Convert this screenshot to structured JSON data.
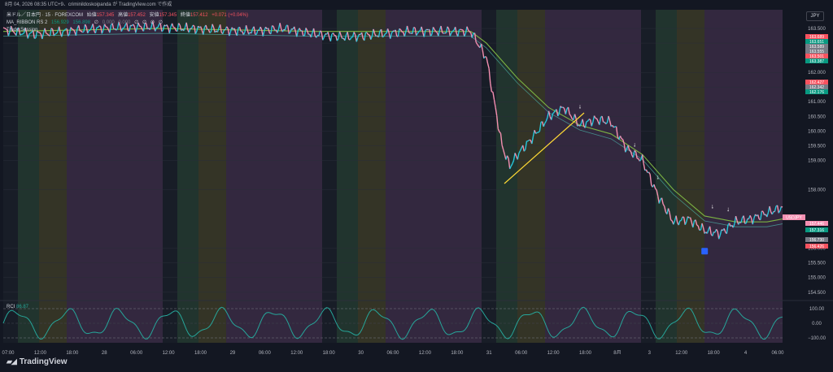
{
  "header": {
    "timestamp_line": "8月 04, 2026 08:35 UTC+9、criminildoskoipanda が TradingView.com で作成"
  },
  "legend": {
    "symbol": "米ドル／日本円 · 15 · FOREXCOM",
    "open_label": "始値",
    "open": "157.345",
    "high_label": "高値",
    "high": "157.452",
    "low_label": "安値",
    "low": "157.345",
    "close_label": "終値",
    "close": "157.412",
    "change": "+0.071 (+0.04%)",
    "indicator1": "MA_RIBBON RS 2",
    "indicator1_values": [
      "156.929",
      "156.898",
      "∅",
      "0.000",
      "0.000",
      "∅",
      "∅",
      "∅",
      "∅"
    ],
    "indicator2": "Trade Session"
  },
  "currency_badge": "JPY",
  "rci": {
    "label": "RCI",
    "value": "86.87",
    "ticks": [
      "100.00",
      "0.00",
      "−100.00"
    ]
  },
  "branding": {
    "name": "TradingView"
  },
  "colors": {
    "background": "#131722",
    "up": "#26c6da",
    "down": "#f48fb1",
    "ma_fast": "#7cb342",
    "ma_slow": "#4db6ac",
    "trendline": "#fdd835",
    "rci_line": "#26a69a",
    "session_purple": "#3a2c44",
    "session_olive": "#3b3a27",
    "session_green": "#243a30",
    "session_blank": "#1a1e28"
  },
  "chart_data": {
    "type": "line",
    "title": "米ドル／日本円 · 15 · FOREXCOM",
    "y_axis_ticks": [
      154.5,
      155.0,
      155.5,
      156.0,
      158.0,
      159.0,
      159.5,
      160.0,
      160.5,
      161.0,
      161.5,
      162.0,
      163.0,
      163.5
    ],
    "ylim": [
      154.3,
      164.0
    ],
    "x_tick_labels": [
      "07:00",
      "12:00",
      "18:00",
      "28",
      "06:00",
      "12:00",
      "18:00",
      "29",
      "06:00",
      "12:00",
      "18:00",
      "30",
      "06:00",
      "12:00",
      "18:00",
      "31",
      "06:00",
      "12:00",
      "18:00",
      "8月",
      "3",
      "12:00",
      "18:00",
      "4",
      "06:00"
    ],
    "price_labels": [
      {
        "value": "163.689",
        "color": "#f7525f"
      },
      {
        "value": "163.651",
        "color": "#089981"
      },
      {
        "value": "163.589",
        "color": "#787b86"
      },
      {
        "value": "163.555",
        "color": "#787b86"
      },
      {
        "value": "163.501",
        "color": "#f7525f"
      },
      {
        "value": "163.387",
        "color": "#089981"
      },
      {
        "value": "162.427",
        "color": "#f7525f"
      },
      {
        "value": "162.342",
        "color": "#787b86"
      },
      {
        "value": "162.176",
        "color": "#089981"
      },
      {
        "value": "157.446",
        "color": "#f48fb1"
      },
      {
        "value": "157.316",
        "color": "#089981"
      },
      {
        "value": "156.730",
        "color": "#787b86"
      },
      {
        "value": "156.426",
        "color": "#f7525f"
      }
    ],
    "last_price_tag": "USDJPY",
    "series": [
      {
        "name": "米ドル／日本円",
        "x": [
          0,
          4,
          8,
          12,
          16,
          20,
          24,
          28,
          32,
          36,
          40,
          44,
          48,
          52,
          56,
          60,
          62,
          63,
          64,
          65,
          66,
          68,
          70,
          72,
          74,
          76,
          78,
          80,
          82,
          84,
          86,
          88,
          90,
          92,
          94,
          96,
          98,
          100
        ],
        "y": [
          163.45,
          163.3,
          163.4,
          163.5,
          163.55,
          163.55,
          163.5,
          163.45,
          163.4,
          163.5,
          163.3,
          163.2,
          163.3,
          163.4,
          163.4,
          163.4,
          162.5,
          161.0,
          159.5,
          158.8,
          159.2,
          159.8,
          160.5,
          160.8,
          160.2,
          160.4,
          160.3,
          159.4,
          159.0,
          157.8,
          156.9,
          157.0,
          156.6,
          156.5,
          156.9,
          157.0,
          157.2,
          157.4
        ]
      },
      {
        "name": "MA_RIBBON RS 2",
        "x": [
          0,
          20,
          40,
          60,
          62,
          66,
          70,
          74,
          78,
          82,
          86,
          90,
          94,
          98,
          100
        ],
        "y": [
          163.4,
          163.5,
          163.4,
          163.4,
          163.0,
          161.8,
          160.8,
          160.2,
          159.9,
          159.2,
          158.0,
          157.1,
          156.9,
          156.9,
          157.0
        ]
      }
    ],
    "rci_series": {
      "name": "RCI",
      "ylim": [
        -100,
        100
      ],
      "last": 86.87
    },
    "grid": true,
    "legend_position": "top-left"
  }
}
